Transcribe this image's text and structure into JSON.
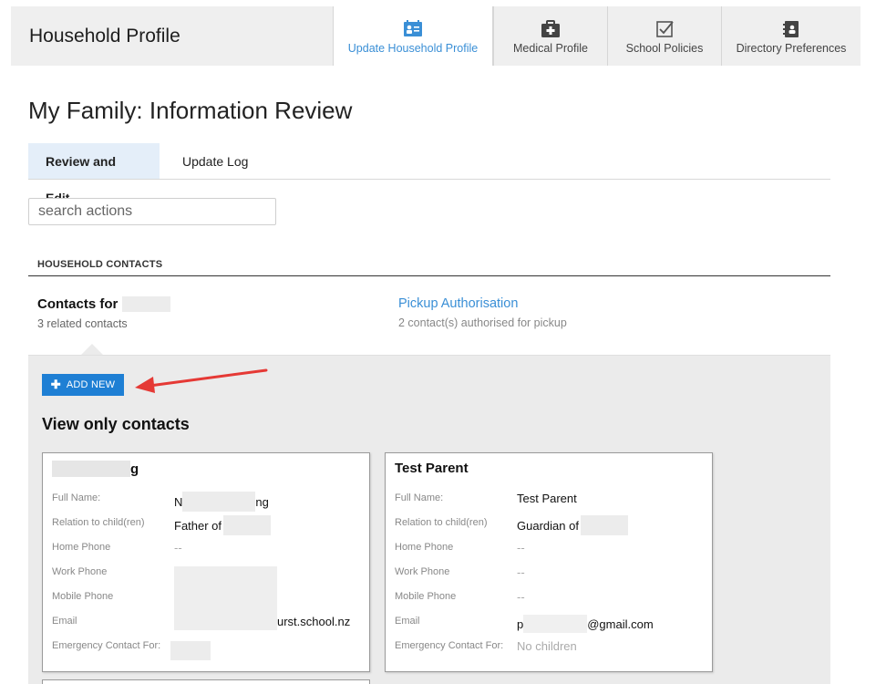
{
  "header": {
    "app_title": "Household Profile",
    "tabs": [
      {
        "label": "Update Household Profile",
        "icon": "id-card-icon",
        "active": true
      },
      {
        "label": "Medical Profile",
        "icon": "medical-kit-icon",
        "active": false
      },
      {
        "label": "School Policies",
        "icon": "checkbox-icon",
        "active": false
      },
      {
        "label": "Directory Preferences",
        "icon": "contact-book-icon",
        "active": false
      }
    ]
  },
  "page_title": "My Family: Information Review",
  "subtabs": {
    "review": "Review and Edit",
    "log": "Update Log"
  },
  "search": {
    "placeholder": "search actions",
    "value": ""
  },
  "section_heading": "HOUSEHOLD CONTACTS",
  "contacts": {
    "title": "Contacts for",
    "count": "3 related contacts"
  },
  "pickup": {
    "link": "Pickup Authorisation",
    "sub": "2 contact(s) authorised for pickup"
  },
  "add_button": "ADD NEW",
  "view_only_heading": "View only contacts",
  "field_labels": {
    "full_name": "Full Name:",
    "relation": "Relation to child(ren)",
    "home_phone": "Home Phone",
    "work_phone": "Work Phone",
    "mobile_phone": "Mobile Phone",
    "email": "Email",
    "emergency": "Emergency Contact For:"
  },
  "cards": [
    {
      "name_suffix": "g",
      "full_name_prefix": "N",
      "full_name_suffix": "ng",
      "relation": "Father of",
      "home_phone": "--",
      "email_suffix": "urst.school.nz"
    },
    {
      "name": "Test Parent",
      "full_name": "Test Parent",
      "relation": "Guardian of",
      "home_phone": "--",
      "work_phone": "--",
      "mobile_phone": "--",
      "email_prefix": "p",
      "email_suffix": "@gmail.com",
      "emergency": "No children"
    }
  ],
  "colors": {
    "accent": "#3a8fd6",
    "button": "#1e7fd4",
    "arrow": "#e53935",
    "panel": "#ebebeb"
  }
}
